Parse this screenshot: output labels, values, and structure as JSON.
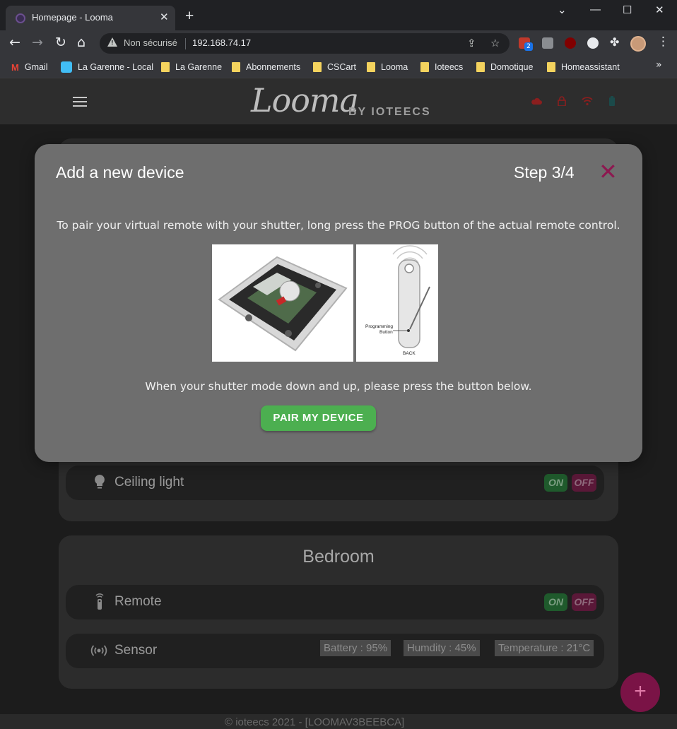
{
  "browser": {
    "tab_title": "Homepage - Looma",
    "not_secure_label": "Non sécurisé",
    "url": "192.168.74.17",
    "extension_badge": "2",
    "bookmarks": [
      "Gmail",
      "La Garenne - Local",
      "La Garenne",
      "Abonnements",
      "CSCart",
      "Looma",
      "Ioteecs",
      "Domotique",
      "Homeassistant"
    ]
  },
  "header": {
    "logo": "Looma",
    "logo_by": "BY IOTEECS",
    "status_icons": [
      "cloud-icon",
      "lock-icon",
      "wifi-icon",
      "battery-icon"
    ],
    "status_colors": {
      "cloud": "#8b1e1e",
      "lock": "#8b1e1e",
      "wifi": "#8b1e1e",
      "battery": "#1b4a4a"
    }
  },
  "modal": {
    "title": "Add a new device",
    "step": "Step 3/4",
    "close_glyph": "✕",
    "instruction": "To pair your virtual remote with your shutter, long press the PROG button of the actual remote control.",
    "remote_label_programming": "Programming",
    "remote_label_button": "Button",
    "remote_label_back": "BACK",
    "instruction2": "When your shutter mode down and up, please press the button below.",
    "pair_button": "PAIR MY DEVICE"
  },
  "rooms": [
    {
      "title": "",
      "devices": [
        {
          "name": "Ceiling light",
          "icon": "bulb-icon",
          "on_label": "ON",
          "off_label": "OFF"
        }
      ]
    },
    {
      "title": "Bedroom",
      "devices": [
        {
          "name": "Remote",
          "icon": "remote-icon",
          "on_label": "ON",
          "off_label": "OFF"
        },
        {
          "name": "Sensor",
          "icon": "sensor-icon",
          "chips": [
            "Battery : 95%",
            "Humdity : 45%",
            "Temperature : 21°C"
          ]
        }
      ]
    }
  ],
  "fab_label": "+",
  "footer_text": "© ioteecs 2021 - [LOOMAV3BEEBCA]",
  "colors": {
    "accent": "#7a1346",
    "success": "#4caf50",
    "modal_bg": "#6e6e6e"
  }
}
